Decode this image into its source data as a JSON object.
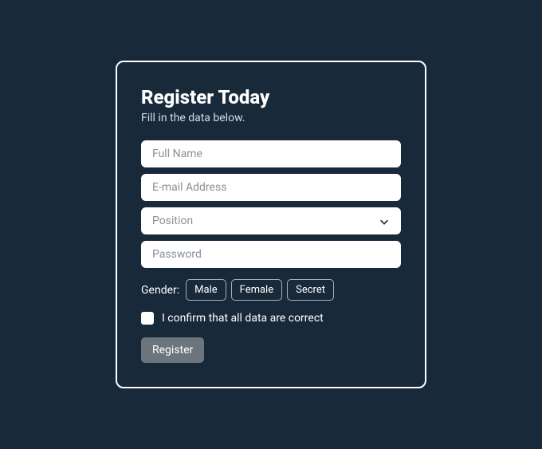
{
  "form": {
    "title": "Register Today",
    "subtitle": "Fill in the data below.",
    "fullname_placeholder": "Full Name",
    "email_placeholder": "E-mail Address",
    "position_placeholder": "Position",
    "password_placeholder": "Password",
    "gender_label": "Gender:",
    "gender_options": {
      "male": "Male",
      "female": "Female",
      "secret": "Secret"
    },
    "confirm_label": "I confirm that all data are correct",
    "submit_label": "Register"
  }
}
